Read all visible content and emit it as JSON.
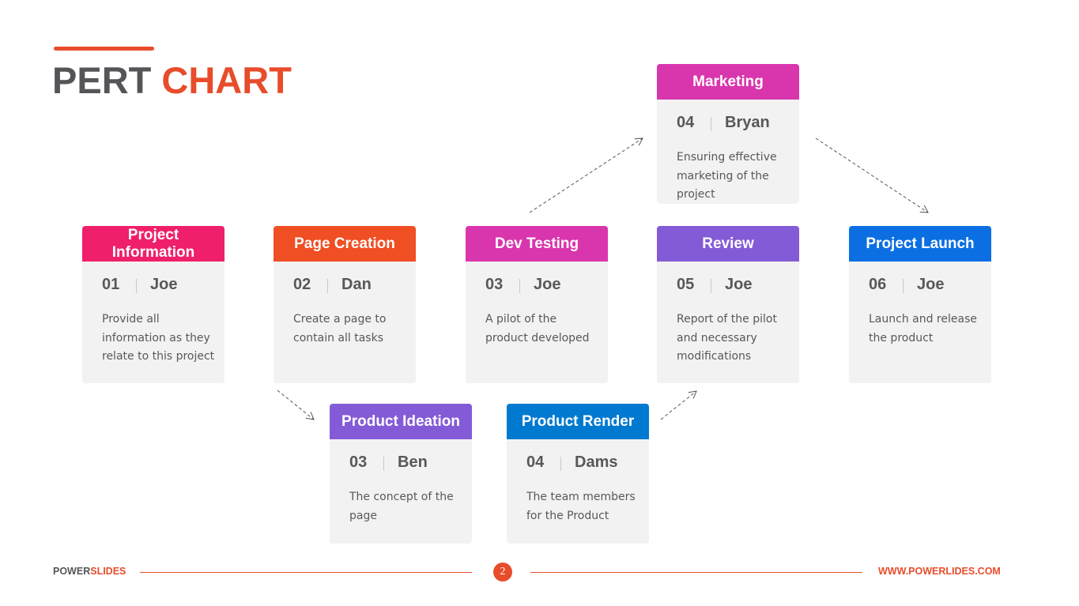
{
  "slide": {
    "title_part1": "PERT",
    "title_part2": "CHART",
    "accent_color": "#e84c2b",
    "tasks": [
      {
        "id": "project-information",
        "title": "Project Information",
        "number": "01",
        "owner": "Joe",
        "description": "Provide all information as they relate to this project",
        "color": "#f01f6b"
      },
      {
        "id": "page-creation",
        "title": "Page Creation",
        "number": "02",
        "owner": "Dan",
        "description": "Create a page to contain all tasks",
        "color": "#f04e23"
      },
      {
        "id": "dev-testing",
        "title": "Dev Testing",
        "number": "03",
        "owner": "Joe",
        "description": "A pilot of the product developed",
        "color": "#d935ad"
      },
      {
        "id": "review",
        "title": "Review",
        "number": "05",
        "owner": "Joe",
        "description": "Report of the pilot and necessary modifications",
        "color": "#845bd6"
      },
      {
        "id": "project-launch",
        "title": "Project Launch",
        "number": "06",
        "owner": "Joe",
        "description": "Launch and release the product",
        "color": "#0b6fe3"
      },
      {
        "id": "marketing",
        "title": "Marketing",
        "number": "04",
        "owner": "Bryan",
        "description": "Ensuring effective marketing of the project",
        "color": "#d935ad"
      },
      {
        "id": "product-ideation",
        "title": "Product Ideation",
        "number": "03",
        "owner": "Ben",
        "description": "The concept of the page",
        "color": "#845bd6"
      },
      {
        "id": "product-render",
        "title": "Product Render",
        "number": "04",
        "owner": "Dams",
        "description": "The team members for the Product",
        "color": "#0079d0"
      }
    ],
    "dependencies": [
      {
        "from": "project-information",
        "to": "page-creation",
        "style": "solid"
      },
      {
        "from": "page-creation",
        "to": "dev-testing",
        "style": "solid"
      },
      {
        "from": "dev-testing",
        "to": "review",
        "style": "solid"
      },
      {
        "from": "review",
        "to": "project-launch",
        "style": "solid"
      },
      {
        "from": "product-ideation",
        "to": "product-render",
        "style": "solid"
      },
      {
        "from": "page-creation",
        "to": "product-ideation",
        "style": "dashed"
      },
      {
        "from": "product-render",
        "to": "review",
        "style": "dashed"
      },
      {
        "from": "dev-testing",
        "to": "marketing",
        "style": "dashed"
      },
      {
        "from": "marketing",
        "to": "project-launch",
        "style": "dashed"
      }
    ]
  },
  "footer": {
    "brand_part1": "POWER",
    "brand_part2": "SLIDES",
    "page_number": "2",
    "url": "WWW.POWERLIDES.COM"
  }
}
